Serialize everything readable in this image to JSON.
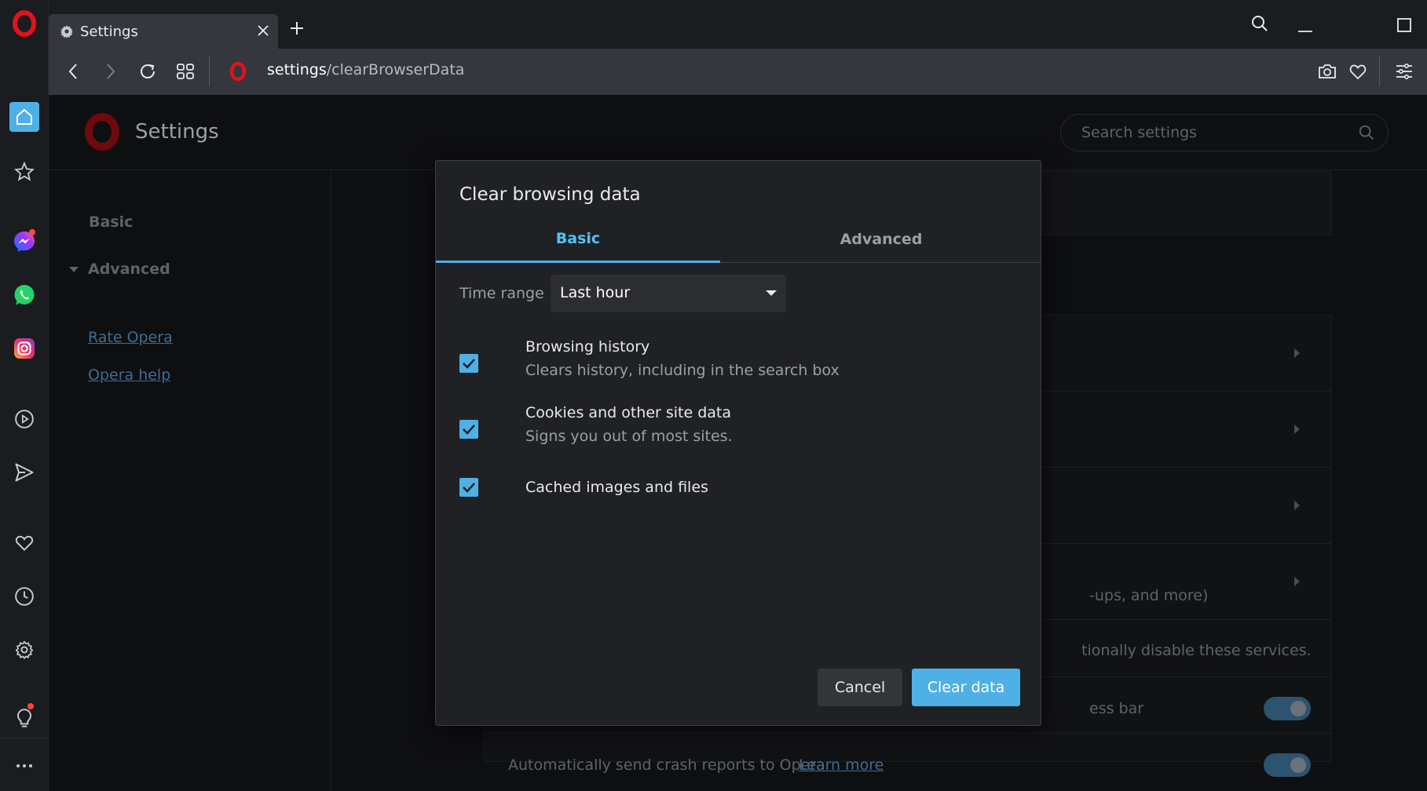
{
  "browser": {
    "tab": {
      "title": "Settings"
    },
    "address_bar": {
      "scheme_part": "settings",
      "path_part": "/clearBrowserData"
    }
  },
  "sidebar": {
    "items": [
      {
        "icon": "home-icon"
      },
      {
        "icon": "star-icon"
      },
      {
        "icon": "messenger-icon"
      },
      {
        "icon": "whatsapp-icon"
      },
      {
        "icon": "instagram-icon"
      },
      {
        "icon": "player-icon"
      },
      {
        "icon": "send-icon"
      },
      {
        "icon": "heart-icon"
      },
      {
        "icon": "history-icon"
      },
      {
        "icon": "gear-icon"
      },
      {
        "icon": "lightbulb-icon"
      },
      {
        "icon": "more-icon"
      }
    ]
  },
  "settings": {
    "title": "Settings",
    "search_placeholder": "Search settings",
    "nav": {
      "basic": "Basic",
      "advanced": "Advanced",
      "rate": "Rate Opera",
      "help": "Opera help"
    },
    "background": {
      "popups_text": "-ups, and more)",
      "services_text": "tionally disable these services.",
      "address_bar_text": "ess bar",
      "crash_text": "Automatically send crash reports to Opera",
      "learn_more": "Learn more"
    }
  },
  "dialog": {
    "title": "Clear browsing data",
    "tabs": {
      "basic": "Basic",
      "advanced": "Advanced"
    },
    "time_range": {
      "label": "Time range",
      "value": "Last hour"
    },
    "options": [
      {
        "title": "Browsing history",
        "desc": "Clears history, including in the search box",
        "checked": true
      },
      {
        "title": "Cookies and other site data",
        "desc": "Signs you out of most sites.",
        "checked": true
      },
      {
        "title": "Cached images and files",
        "desc": "",
        "checked": true
      }
    ],
    "buttons": {
      "cancel": "Cancel",
      "clear": "Clear data"
    }
  },
  "colors": {
    "accent": "#4fb0e6",
    "opera_red": "#e0131d",
    "background": "#0e0f11",
    "dialog": "#202124"
  }
}
